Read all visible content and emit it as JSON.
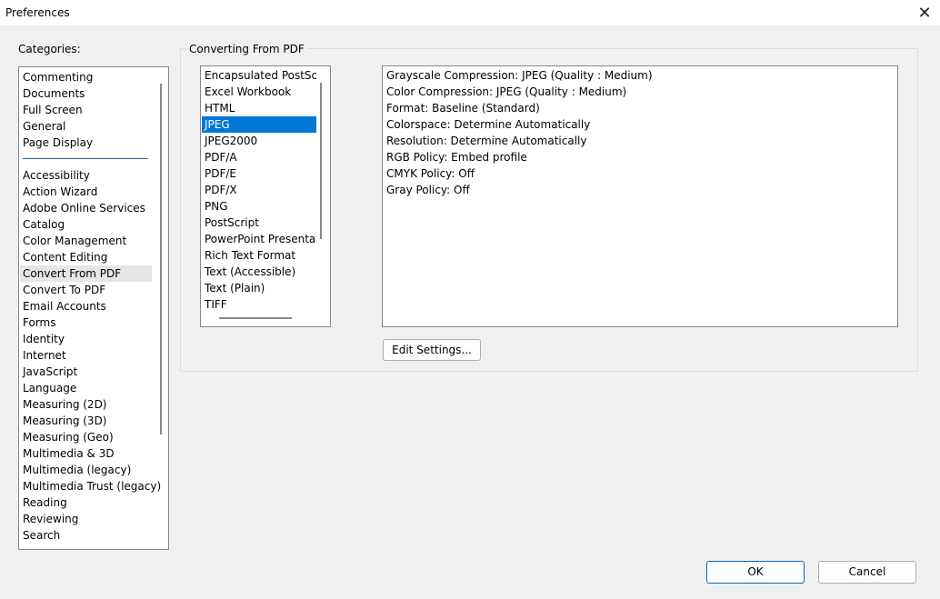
{
  "window": {
    "title": "Preferences",
    "close_icon": "close-icon"
  },
  "categories": {
    "label": "Categories:",
    "top_items": [
      "Commenting",
      "Documents",
      "Full Screen",
      "General",
      "Page Display"
    ],
    "items": [
      "Accessibility",
      "Action Wizard",
      "Adobe Online Services",
      "Catalog",
      "Color Management",
      "Content Editing",
      "Convert From PDF",
      "Convert To PDF",
      "Email Accounts",
      "Forms",
      "Identity",
      "Internet",
      "JavaScript",
      "Language",
      "Measuring (2D)",
      "Measuring (3D)",
      "Measuring (Geo)",
      "Multimedia & 3D",
      "Multimedia (legacy)",
      "Multimedia Trust (legacy)",
      "Reading",
      "Reviewing",
      "Search"
    ],
    "selected": "Convert From PDF"
  },
  "panel": {
    "title": "Converting From PDF",
    "formats": [
      "Encapsulated PostScript",
      "Excel Workbook",
      "HTML",
      "JPEG",
      "JPEG2000",
      "PDF/A",
      "PDF/E",
      "PDF/X",
      "PNG",
      "PostScript",
      "PowerPoint Presentation",
      "Rich Text Format",
      "Text (Accessible)",
      "Text (Plain)",
      "TIFF"
    ],
    "selected_format": "JPEG",
    "settings": [
      "Grayscale Compression: JPEG (Quality : Medium)",
      "Color Compression: JPEG (Quality : Medium)",
      "Format: Baseline (Standard)",
      "Colorspace: Determine Automatically",
      "Resolution: Determine Automatically",
      "RGB Policy: Embed profile",
      "CMYK Policy: Off",
      "Gray Policy: Off"
    ],
    "edit_button": "Edit Settings..."
  },
  "footer": {
    "ok": "OK",
    "cancel": "Cancel"
  },
  "colors": {
    "selection": "#0078d7",
    "separator": "#2d6fb5"
  }
}
